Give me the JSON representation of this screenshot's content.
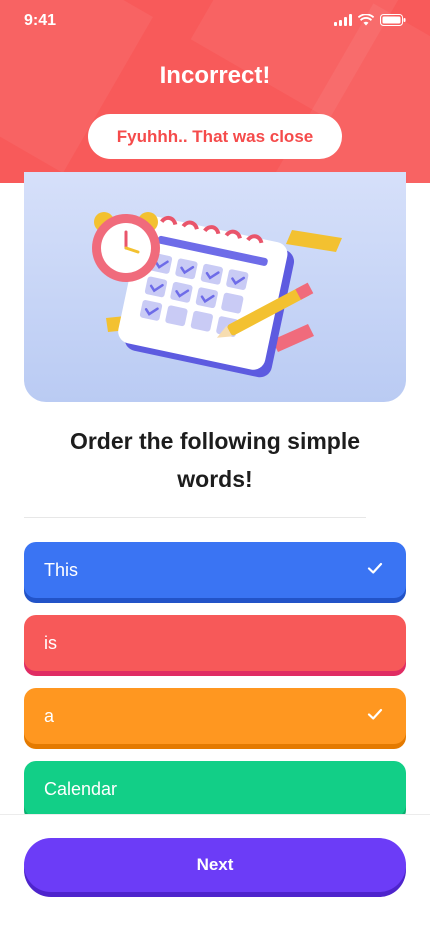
{
  "status_bar": {
    "time": "9:41"
  },
  "header": {
    "title": "Incorrect!",
    "feedback": "Fyuhhh.. That was close",
    "color": "#F85A5A"
  },
  "question": {
    "text": "Order the following simple words!"
  },
  "options": [
    {
      "label": "This",
      "checked": true,
      "color": "#3A74F3"
    },
    {
      "label": "is",
      "checked": false,
      "color": "#F75959"
    },
    {
      "label": "a",
      "checked": true,
      "color": "#FF9720"
    },
    {
      "label": "Calendar",
      "checked": false,
      "color": "#12CF87"
    }
  ],
  "footer": {
    "next_label": "Next",
    "color": "#6C3CF7"
  }
}
